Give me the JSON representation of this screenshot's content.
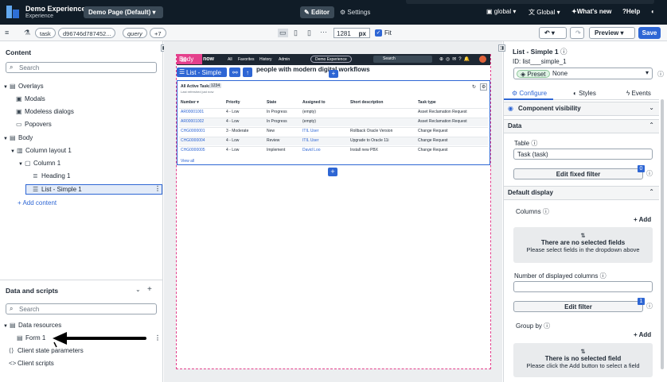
{
  "topbar": {
    "app_title": "Demo Experience",
    "app_subtitle": "Experience",
    "page_select": "Demo Page (Default)",
    "editor_label": "Editor",
    "settings_label": "Settings",
    "scope_label": "global",
    "lang_label": "Global",
    "whats_new": "What's new",
    "help": "Help"
  },
  "toolbar": {
    "pills": [
      "task",
      "d96746d787452...",
      "query",
      "+7"
    ],
    "width_value": "1281",
    "width_unit": "px",
    "fit_label": "Fit",
    "preview_label": "Preview",
    "save_label": "Save"
  },
  "left_panel": {
    "content_title": "Content",
    "search_placeholder": "Search",
    "tree": [
      {
        "label": "Overlays"
      },
      {
        "label": "Modals"
      },
      {
        "label": "Modeless dialogs"
      },
      {
        "label": "Popovers"
      },
      {
        "label": "Body"
      },
      {
        "label": "Column layout 1"
      },
      {
        "label": "Column 1"
      },
      {
        "label": "Heading 1"
      },
      {
        "label": "List - Simple 1"
      }
    ],
    "add_content": "Add content",
    "data_title": "Data and scripts",
    "data_search_placeholder": "Search",
    "data_tree": [
      {
        "label": "Data resources"
      },
      {
        "label": "Form 1"
      },
      {
        "label": "Client state parameters"
      },
      {
        "label": "Client scripts"
      }
    ]
  },
  "canvas": {
    "body_label": "Body",
    "nav": [
      "All",
      "Favorites",
      "History",
      "Admin"
    ],
    "nav_brand": "now",
    "nav_pill": "Demo Experience",
    "nav_search": "Search",
    "selected_label": "List - Simple 1",
    "heading_text": "people with modern digital workflows",
    "list": {
      "title": "All Active Tasks",
      "count_badge": "1234",
      "subtitle": "Last refreshed just now",
      "columns": [
        "Number",
        "Priority",
        "State",
        "Assigned to",
        "Short description",
        "Task type"
      ],
      "rows": [
        [
          "AR00001001",
          "4 - Low",
          "In Progress",
          "(empty)",
          "",
          "Asset Reclamation Request"
        ],
        [
          "AR00001002",
          "4 - Low",
          "In Progress",
          "(empty)",
          "",
          "Asset Reclamation Request"
        ],
        [
          "CHG0000001",
          "3 - Moderate",
          "New",
          "ITIL User",
          "Rollback Oracle Version",
          "Change Request"
        ],
        [
          "CHG0000004",
          "4 - Low",
          "Review",
          "ITIL User",
          "Upgrade to Oracle 11i",
          "Change Request"
        ],
        [
          "CHG0000005",
          "4 - Low",
          "Implement",
          "David Loo",
          "Install new PBX",
          "Change Request"
        ]
      ],
      "view_all": "View all"
    }
  },
  "right_panel": {
    "title": "List - Simple 1",
    "id_label": "ID: list___simple_1",
    "preset_label": "Preset",
    "preset_value": "None",
    "tabs": [
      "Configure",
      "Styles",
      "Events"
    ],
    "visibility_label": "Component visibility",
    "data_section": "Data",
    "table_label": "Table",
    "table_value": "Task (task)",
    "edit_fixed_filter": "Edit fixed filter",
    "fixed_filter_count": "0",
    "default_display": "Default display",
    "columns_label": "Columns",
    "add_label": "Add",
    "no_fields_title": "There are no selected fields",
    "no_fields_text": "Please select fields in the dropdown above",
    "num_columns_label": "Number of displayed columns",
    "edit_filter": "Edit filter",
    "filter_count": "1",
    "group_by_label": "Group by",
    "group_add": "Add",
    "no_field_title": "There is no selected field",
    "no_field_text": "Please click the Add button to select a field"
  },
  "colors": {
    "accent": "#2e66d4",
    "body_tag": "#e4408c",
    "topbar": "#101c27"
  }
}
